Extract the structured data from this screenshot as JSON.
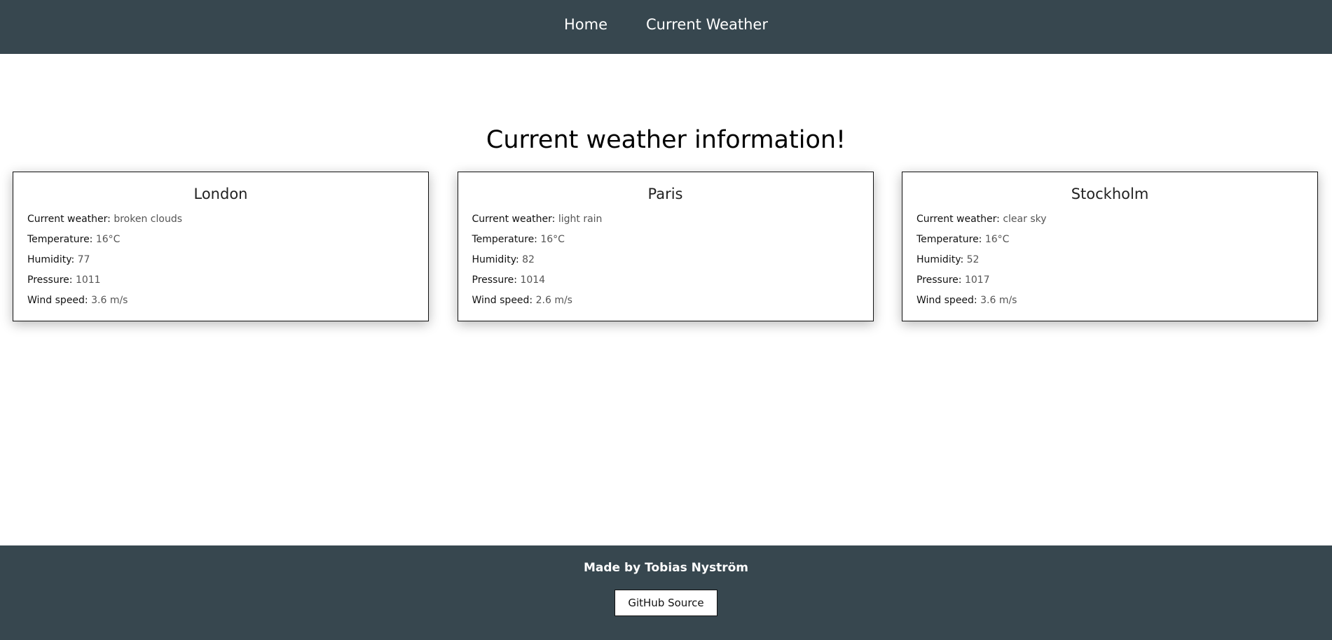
{
  "nav": {
    "home": "Home",
    "current_weather": "Current Weather"
  },
  "page": {
    "title": "Current weather information!"
  },
  "labels": {
    "weather": "Current weather:",
    "temperature": "Temperature:",
    "humidity": "Humidity:",
    "pressure": "Pressure:",
    "wind": "Wind speed:"
  },
  "cities": [
    {
      "name": "London",
      "weather": "broken clouds",
      "temperature": "16°C",
      "humidity": "77",
      "pressure": "1011",
      "wind": "3.6 m/s"
    },
    {
      "name": "Paris",
      "weather": "light rain",
      "temperature": "16°C",
      "humidity": "82",
      "pressure": "1014",
      "wind": "2.6 m/s"
    },
    {
      "name": "Stockholm",
      "weather": "clear sky",
      "temperature": "16°C",
      "humidity": "52",
      "pressure": "1017",
      "wind": "3.6 m/s"
    }
  ],
  "footer": {
    "made_by": "Made by Tobias Nyström",
    "github_label": "GitHub Source"
  },
  "colors": {
    "header_bg": "#37474f",
    "footer_bg": "#37474f"
  }
}
